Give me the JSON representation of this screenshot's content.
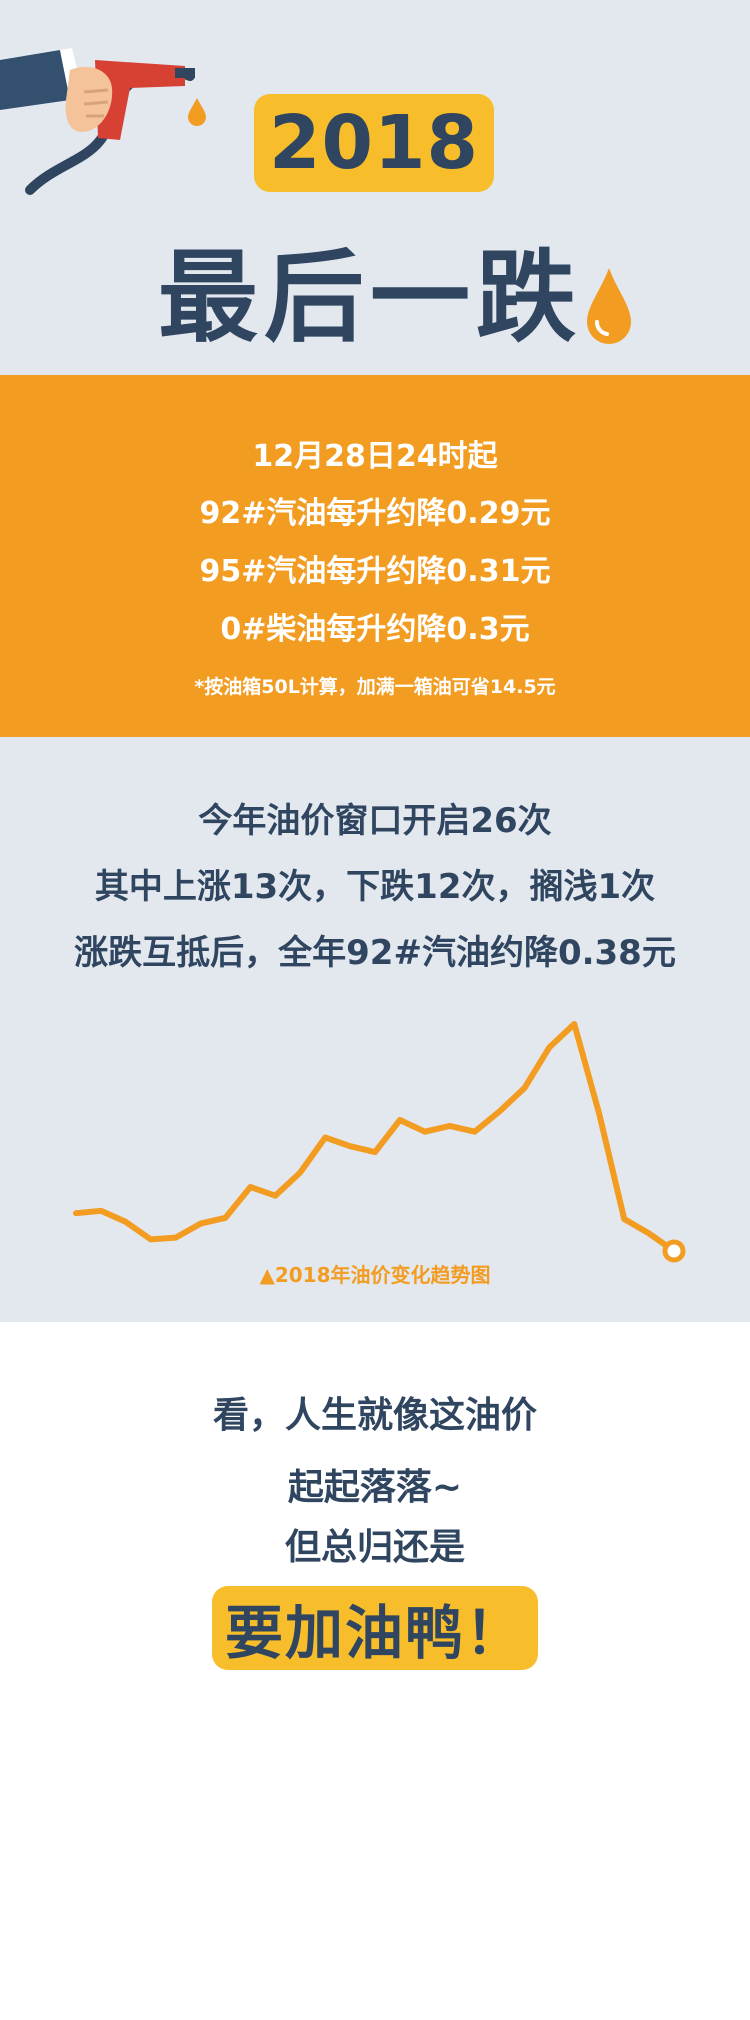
{
  "header": {
    "year": "2018",
    "title": "最后一跌"
  },
  "price_cut": {
    "effective_time": "12月28日24时起",
    "lines": [
      "92#汽油每升约降0.29元",
      "95#汽油每升约降0.31元",
      "0#柴油每升约降0.3元"
    ],
    "note": "*按油箱50L计算，加满一箱油可省14.5元"
  },
  "stats": {
    "lines": [
      "今年油价窗口开启26次",
      "其中上涨13次，下跌12次，搁浅1次",
      "涨跌互抵后，全年92#汽油约降0.38元"
    ]
  },
  "chart_data": {
    "type": "line",
    "title": "▲2018年油价变化趋势图",
    "x": [
      1,
      2,
      3,
      4,
      5,
      6,
      7,
      8,
      9,
      10,
      11,
      12,
      13,
      14,
      15,
      16,
      17,
      18,
      19,
      20,
      21,
      22,
      23,
      24,
      25
    ],
    "series": [
      {
        "values": [
          5.0,
          5.4,
          3.5,
          0.5,
          0.8,
          3.2,
          4.2,
          9.5,
          8.0,
          12.0,
          18.0,
          16.5,
          15.5,
          21.0,
          19.0,
          20.0,
          19.0,
          22.5,
          26.5,
          33.5,
          37.5,
          22.0,
          4.0,
          1.5,
          -1.5
        ]
      }
    ],
    "colors": {
      "line": "#f39c22",
      "end_marker": "#ffffff"
    },
    "grid": false,
    "axes_visible": false
  },
  "footer": {
    "lines": [
      "看，人生就像这油价",
      "起起落落~",
      "但总归还是"
    ],
    "cheer": "要加油鸭！"
  },
  "colors": {
    "navy": "#2f4560",
    "orange": "#f39c22",
    "yellow": "#f8bd2a",
    "light_bg": "#e3e8ee"
  },
  "icons": [
    "fuel-nozzle-icon",
    "fuel-drop-icon"
  ]
}
